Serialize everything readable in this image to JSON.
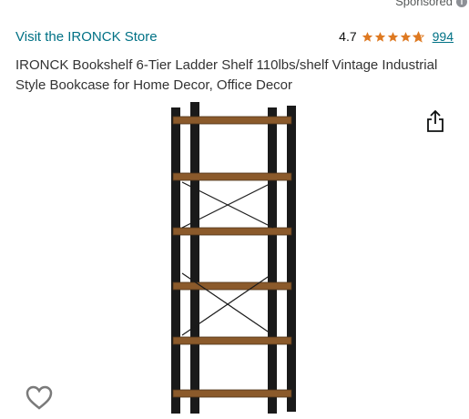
{
  "sponsored": {
    "label": "Sponsored"
  },
  "store": {
    "link_text": "Visit the IRONCK Store"
  },
  "rating": {
    "value": "4.7",
    "count": "994",
    "stars": 4.7
  },
  "product": {
    "title": "IRONCK Bookshelf 6-Tier Ladder Shelf 110lbs/shelf Vintage Industrial Style Bookcase for Home Decor, Office Decor",
    "image_alt": "6-tier ladder bookshelf"
  },
  "icons": {
    "share": "share-icon",
    "wishlist": "heart-icon",
    "info": "info-icon"
  },
  "colors": {
    "link": "#007185",
    "star": "#de7921",
    "wood": "#8b5a2b",
    "metal": "#1a1a1a"
  }
}
